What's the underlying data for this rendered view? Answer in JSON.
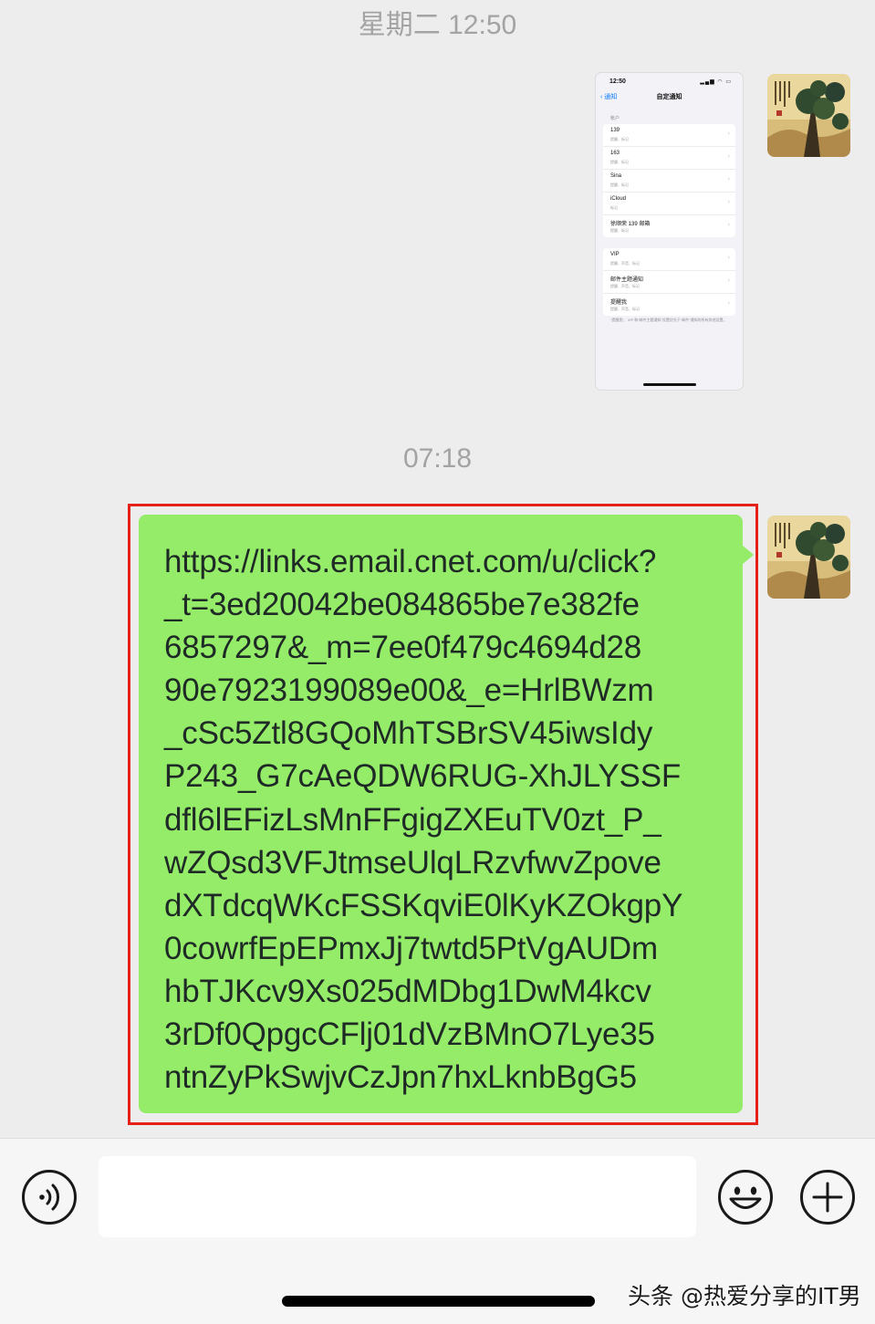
{
  "chat": {
    "timestamp_1": "星期二 12:50",
    "timestamp_2": "07:18"
  },
  "image_message": {
    "status_time": "12:50",
    "status_icons": "▂▄▆ ◠ ▭",
    "back_label": "通知",
    "title": "自定通知",
    "section_label": "帐户",
    "accounts": [
      {
        "title": "139",
        "subtitle": "提醒、标记"
      },
      {
        "title": "163",
        "subtitle": "提醒、标记"
      },
      {
        "title": "Sina",
        "subtitle": "提醒、标记"
      },
      {
        "title": "iCloud",
        "subtitle": "标记"
      },
      {
        "title": "徐顺荣 139 邮箱",
        "subtitle": "提醒、标记"
      }
    ],
    "others": [
      {
        "title": "VIP",
        "subtitle": "提醒、声音、标记"
      },
      {
        "title": "邮件主题通知",
        "subtitle": "提醒、声音、标记"
      },
      {
        "title": "提醒我",
        "subtitle": "提醒、声音、标记"
      }
    ],
    "footer": "“提醒我”、VIP 和“邮件主题通知”设置优先于“邮件”通知的所有其他设置。"
  },
  "text_message": {
    "lines": [
      "https://links.email.cnet.com/u/click?",
      "_t=3ed20042be084865be7e382fe",
      "6857297&_m=7ee0f479c4694d28",
      "90e7923199089e00&_e=HrlBWzm",
      "_cSc5Ztl8GQoMhTSBrSV45iwsIdy",
      "P243_G7cAeQDW6RUG-XhJLYSSF",
      "dfl6lEFizLsMnFFgigZXEuTV0zt_P_",
      "wZQsd3VFJtmseUlqLRzvfwvZpove",
      "dXTdcqWKcFSSKqviE0lKyKZOkgpY",
      "0cowrfEpEPmxJj7twtd5PtVgAUDm",
      "hbTJKcv9Xs025dMDbg1DwM4kcv",
      "3rDf0QpgcCFlj01dVzBMnO7Lye35",
      "ntnZyPkSwjvCzJpn7hxLknbBgG5"
    ]
  },
  "input_bar": {
    "voice_icon": "voice-icon",
    "emoji_icon": "emoji-icon",
    "plus_icon": "plus-icon"
  },
  "watermark": "头条 @热爱分享的IT男",
  "colors": {
    "bubble": "#95ec69",
    "highlight": "#e62117",
    "background": "#ededed"
  }
}
